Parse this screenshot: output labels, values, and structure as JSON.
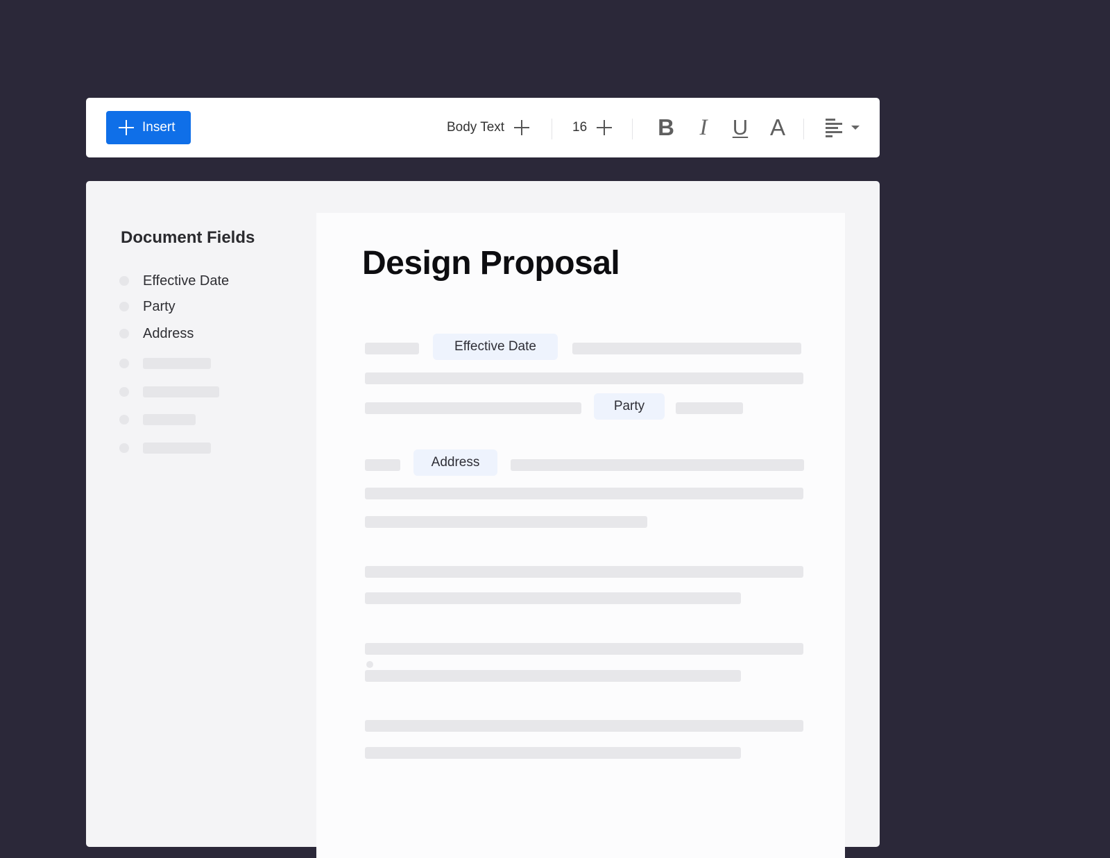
{
  "toolbar": {
    "insert_label": "Insert",
    "text_style": "Body Text",
    "font_size": "16",
    "bold_glyph": "B",
    "italic_glyph": "I",
    "underline_glyph": "U",
    "text_color_glyph": "A",
    "alignment": "left"
  },
  "sidebar": {
    "title": "Document Fields",
    "fields": [
      {
        "label": "Effective Date"
      },
      {
        "label": "Party"
      },
      {
        "label": "Address"
      }
    ]
  },
  "document": {
    "title": "Design Proposal",
    "chips": {
      "effective_date": "Effective Date",
      "party": "Party",
      "address": "Address"
    }
  },
  "colors": {
    "accent": "#0f6fe8",
    "background": "#2b2839",
    "chip_bg": "#eef3fd",
    "skeleton": "#e7e7ea"
  }
}
